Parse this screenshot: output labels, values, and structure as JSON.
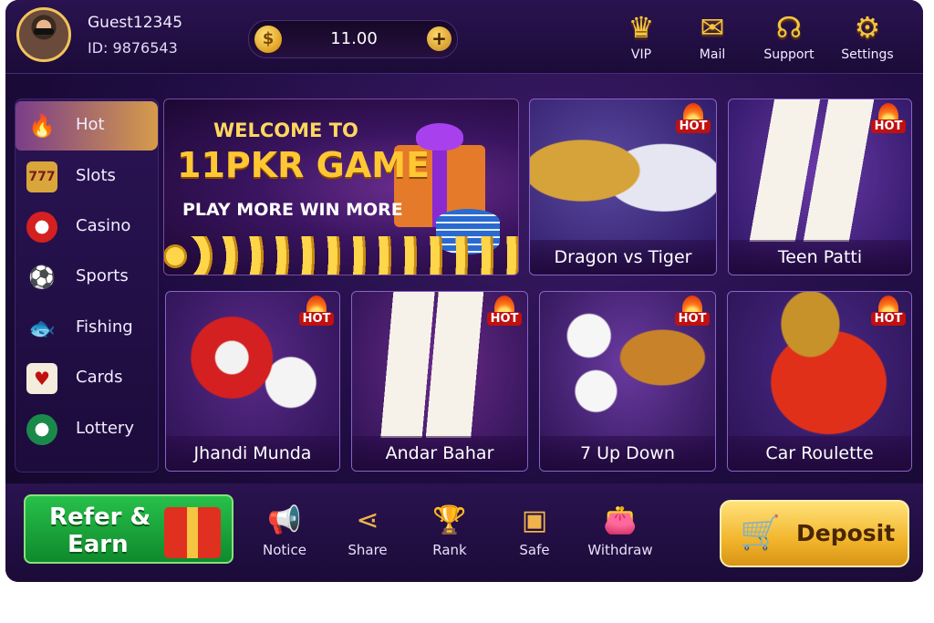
{
  "user": {
    "name": "Guest12345",
    "id": "ID: 9876543"
  },
  "balance": {
    "amount": "11.00",
    "coin_icon": "rupee-coin-icon",
    "coin_symbol": "$"
  },
  "top_nav": [
    {
      "label": "VIP",
      "icon": "crown-icon"
    },
    {
      "label": "Mail",
      "icon": "mail-icon"
    },
    {
      "label": "Support",
      "icon": "headset-icon"
    },
    {
      "label": "Settings",
      "icon": "gear-icon"
    }
  ],
  "sidebar": {
    "items": [
      {
        "label": "Hot",
        "icon": "fire-icon",
        "active": true
      },
      {
        "label": "Slots",
        "icon": "slot-machine-icon"
      },
      {
        "label": "Casino",
        "icon": "poker-chip-icon"
      },
      {
        "label": "Sports",
        "icon": "soccer-ball-icon"
      },
      {
        "label": "Fishing",
        "icon": "fish-icon"
      },
      {
        "label": "Cards",
        "icon": "playing-cards-icon"
      },
      {
        "label": "Lottery",
        "icon": "lottery-ball-icon"
      }
    ]
  },
  "banner": {
    "line1": "WELCOME TO",
    "line2": "11PKR GAME",
    "line3": "PLAY MORE WIN MORE"
  },
  "games": [
    {
      "name": "Dragon vs Tiger",
      "badge": "HOT"
    },
    {
      "name": "Teen Patti",
      "badge": "HOT"
    },
    {
      "name": "Jhandi Munda",
      "badge": "HOT"
    },
    {
      "name": "Andar Bahar",
      "badge": "HOT"
    },
    {
      "name": "7 Up Down",
      "badge": "HOT"
    },
    {
      "name": "Car Roulette",
      "badge": "HOT"
    }
  ],
  "bottom": {
    "refer": {
      "line1": "Refer &",
      "line2": "Earn"
    },
    "items": [
      {
        "label": "Notice",
        "icon": "megaphone-icon"
      },
      {
        "label": "Share",
        "icon": "share-icon"
      },
      {
        "label": "Rank",
        "icon": "trophy-icon"
      },
      {
        "label": "Safe",
        "icon": "safe-icon"
      },
      {
        "label": "Withdraw",
        "icon": "wallet-icon"
      }
    ],
    "deposit": {
      "label": "Deposit",
      "icon": "shopping-cart-icon"
    }
  },
  "colors": {
    "accent_gold": "#f4c542",
    "bg_purple": "#1e0c40",
    "refer_green": "#1aa33c",
    "hot_red": "#c01010"
  }
}
